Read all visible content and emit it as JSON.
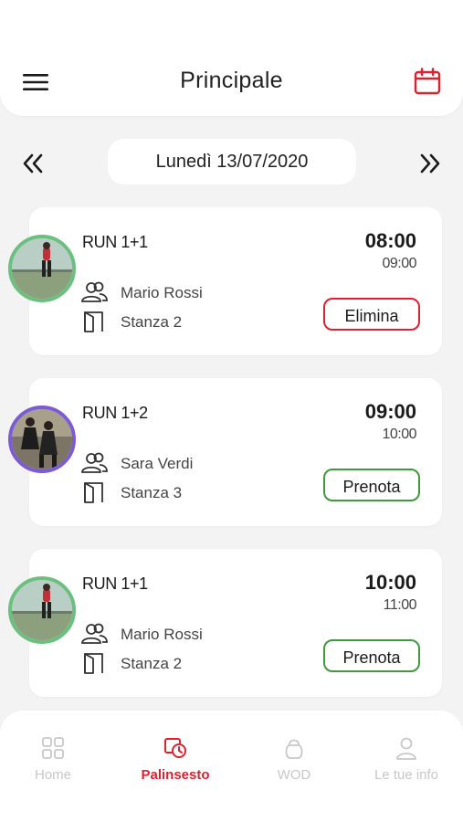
{
  "header": {
    "title": "Principale"
  },
  "date_nav": {
    "date": "Lunedì 13/07/2020"
  },
  "sessions": [
    {
      "title": "RUN 1+1",
      "start": "08:00",
      "end": "09:00",
      "trainer": "Mario Rossi",
      "room": "Stanza 2",
      "action": "Elimina",
      "action_color": "#e0202e",
      "avatar_border": "#6bbf7f"
    },
    {
      "title": "RUN 1+2",
      "start": "09:00",
      "end": "10:00",
      "trainer": "Sara Verdi",
      "room": "Stanza 3",
      "action": "Prenota",
      "action_color": "#3f9a3c",
      "avatar_border": "#7c5bd3"
    },
    {
      "title": "RUN 1+1",
      "start": "10:00",
      "end": "11:00",
      "trainer": "Mario Rossi",
      "room": "Stanza 2",
      "action": "Prenota",
      "action_color": "#3f9a3c",
      "avatar_border": "#6bbf7f"
    }
  ],
  "tabs": [
    {
      "label": "Home",
      "icon": "grid-icon",
      "active": false
    },
    {
      "label": "Palinsesto",
      "icon": "schedule-icon",
      "active": true
    },
    {
      "label": "WOD",
      "icon": "kettlebell-icon",
      "active": false
    },
    {
      "label": "Le tue info",
      "icon": "user-icon",
      "active": false
    }
  ],
  "colors": {
    "accent": "#e0202e",
    "book": "#3f9a3c",
    "background": "#f3f3f3"
  }
}
